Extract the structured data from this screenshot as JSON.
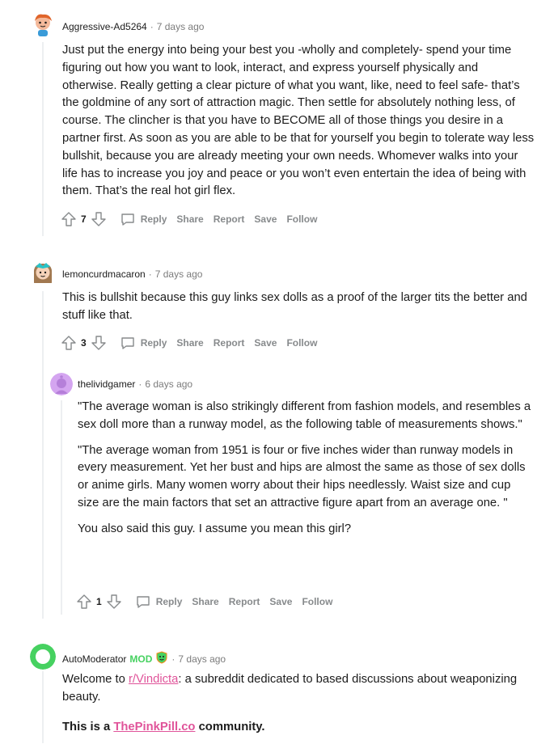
{
  "comments": [
    {
      "author": "Aggressive-Ad5264",
      "sep": "·",
      "time": "7 days ago",
      "text": "Just put the energy into being your best you -wholly and completely- spend your time figuring out how you want to look, interact, and express yourself physically and otherwise. Really getting a clear picture of what you want, like, need to feel safe- that’s the goldmine of any sort of attraction magic. Then settle for absolutely nothing less, of course. The clincher is that you have to BECOME all of those things you desire in a partner first. As soon as you are able to be that for yourself you begin to tolerate way less bullshit, because you are already meeting your own needs. Whomever walks into your life has to increase you joy and peace or you won’t even entertain the idea of being with them. That’s the real hot girl flex.",
      "score": "7"
    },
    {
      "author": "lemoncurdmacaron",
      "sep": "·",
      "time": "7 days ago",
      "text": "This is bullshit because this guy links sex dolls as a proof of the larger tits the better and stuff like that.",
      "score": "3"
    },
    {
      "author": "thelividgamer",
      "sep": "·",
      "time": "6 days ago",
      "paragraphs": [
        "\"The average woman is also strikingly different from fashion models, and resembles a sex doll more than a runway model, as the following table of measurements shows.\"",
        "\"The average woman from 1951 is four or five inches wider than runway models in every measurement. Yet her bust and hips are almost the same as those of sex dolls or anime girls. Many women worry about their hips needlessly. Waist size and cup size are the main factors that set an attractive figure apart from an average one. \"",
        "You also said this guy. I assume you mean this girl?"
      ],
      "score": "1"
    }
  ],
  "actions": {
    "reply": "Reply",
    "share": "Share",
    "report": "Report",
    "save": "Save",
    "follow": "Follow"
  },
  "automod": {
    "author": "AutoModerator",
    "badge": "MOD",
    "sep": "·",
    "time": "7 days ago",
    "welcome_prefix": "Welcome to ",
    "subreddit_link": "r/Vindicta",
    "welcome_suffix": ": a subreddit dedicated to based discussions about weaponizing beauty.",
    "community_prefix": "This is a ",
    "community_link": "ThePinkPill.co",
    "community_suffix": " community."
  },
  "colors": {
    "accent_link": "#e0549a",
    "mod_green": "#46d160",
    "meta_gray": "#7c7c7c",
    "action_gray": "#878a8c",
    "thread_line": "#edeff1"
  }
}
